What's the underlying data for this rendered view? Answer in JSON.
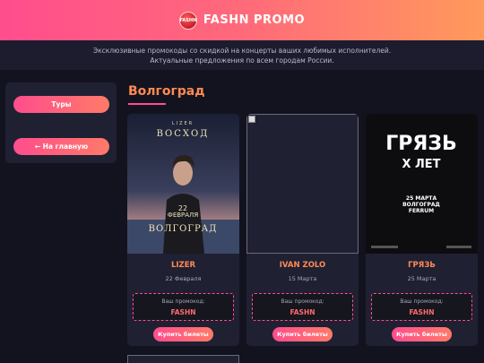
{
  "header": {
    "logo_text": "FASHN",
    "title": "FASHN PROMO"
  },
  "subheader": {
    "line1": "Эксклюзивные промокоды со скидкой на концерты ваших любимых исполнителей.",
    "line2": "Актуальные предложения по всем городам России."
  },
  "sidebar": {
    "tours_label": "Туры",
    "home_label": "← На главную"
  },
  "city": "Волгоград",
  "cards": [
    {
      "artist": "LIZER",
      "date": "22 Февраля",
      "promo_label": "Ваш промокод:",
      "promo_code": "FASHN",
      "buy_label": "Купить билеты",
      "poster": {
        "top": "LIZER",
        "title": "ВОСХОД",
        "day": "22",
        "month": "ФЕВРАЛЯ",
        "city": "ВОЛГОГРАД"
      }
    },
    {
      "artist": "IVAN ZOLO",
      "date": "15 Марта",
      "promo_label": "Ваш промокод:",
      "promo_code": "FASHN",
      "buy_label": "Купить билеты"
    },
    {
      "artist": "ГРЯЗЬ",
      "date": "25 Марта",
      "promo_label": "Ваш промокод:",
      "promo_code": "FASHN",
      "buy_label": "Купить билеты",
      "poster": {
        "title1": "ГРЯЗЬ",
        "title2": "X ЛЕТ",
        "line1": "25 МАРТА",
        "line2": "ВОЛГОГРАД",
        "line3": "FERRUM"
      }
    }
  ],
  "colors": {
    "accent": "#ff4d8d",
    "accent2": "#ff8a52",
    "bg": "#13131f",
    "card": "#202033"
  }
}
